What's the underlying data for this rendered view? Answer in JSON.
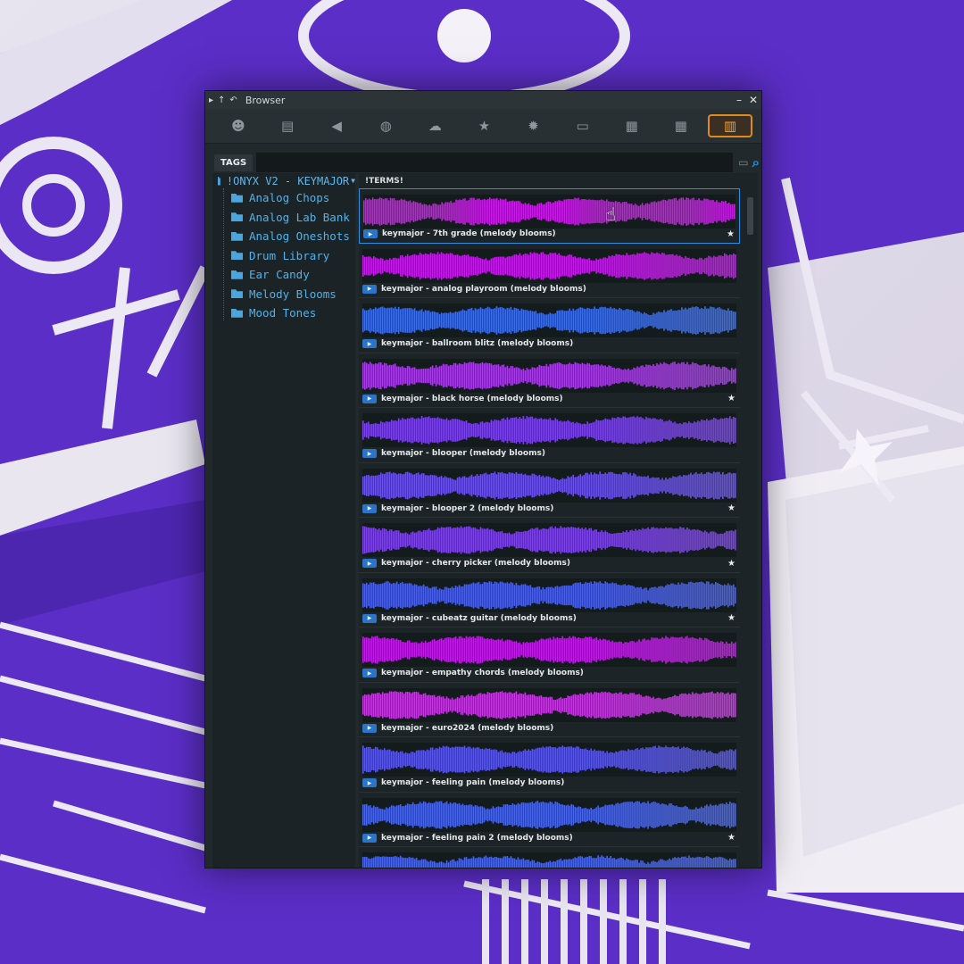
{
  "window": {
    "title": "Browser"
  },
  "icon_bar": [
    {
      "icon": "smiley-icon",
      "glyph": "☻",
      "active": false
    },
    {
      "icon": "document-icon",
      "glyph": "▤",
      "active": false
    },
    {
      "icon": "speaker-icon",
      "glyph": "◀",
      "active": false
    },
    {
      "icon": "globe-icon",
      "glyph": "◍",
      "active": false
    },
    {
      "icon": "cloud-icon",
      "glyph": "☁",
      "active": false
    },
    {
      "icon": "star-icon",
      "glyph": "★",
      "active": false
    },
    {
      "icon": "gear-icon",
      "glyph": "✹",
      "active": false
    },
    {
      "icon": "folder-icon",
      "glyph": "▭",
      "active": false
    },
    {
      "icon": "piano-roll-icon",
      "glyph": "▦",
      "active": false
    },
    {
      "icon": "channel-rack-icon",
      "glyph": "▦",
      "active": false
    },
    {
      "icon": "plugin-database-icon",
      "glyph": "▥",
      "active": true
    }
  ],
  "tags": {
    "label": "TAGS"
  },
  "tree": {
    "root": "!ONYX V2 - KEYMAJOR",
    "items": [
      "Analog Chops",
      "Analog Lab Bank",
      "Analog Oneshots",
      "Drum Library",
      "Ear Candy",
      "Melody Blooms",
      "Mood Tones"
    ]
  },
  "files": {
    "header": "!TERMS!",
    "rows": [
      {
        "name": "keymajor - 7th grade (melody blooms)",
        "starred": true,
        "selected": true,
        "color": "#c81ee6",
        "seed": 3
      },
      {
        "name": "keymajor - analog playroom (melody blooms)",
        "starred": false,
        "selected": false,
        "color": "#c21ee8",
        "seed": 7
      },
      {
        "name": "keymajor - ballroom blitz (melody blooms)",
        "starred": false,
        "selected": false,
        "color": "#3d6ee8",
        "seed": 11
      },
      {
        "name": "keymajor - black horse (melody blooms)",
        "starred": true,
        "selected": false,
        "color": "#a63de6",
        "seed": 13
      },
      {
        "name": "keymajor - blooper (melody blooms)",
        "starred": false,
        "selected": false,
        "color": "#7a44ea",
        "seed": 17
      },
      {
        "name": "keymajor - blooper 2 (melody blooms)",
        "starred": true,
        "selected": false,
        "color": "#6a52ea",
        "seed": 19
      },
      {
        "name": "keymajor - cherry picker (melody blooms)",
        "starred": true,
        "selected": false,
        "color": "#7d45e8",
        "seed": 23
      },
      {
        "name": "keymajor - cubeatz guitar (melody blooms)",
        "starred": true,
        "selected": false,
        "color": "#4b62e8",
        "seed": 29
      },
      {
        "name": "keymajor - empathy chords (melody blooms)",
        "starred": false,
        "selected": false,
        "color": "#c01ee6",
        "seed": 31
      },
      {
        "name": "keymajor - euro2024 (melody blooms)",
        "starred": false,
        "selected": false,
        "color": "#c53ae0",
        "seed": 37
      },
      {
        "name": "keymajor - feeling pain (melody blooms)",
        "starred": false,
        "selected": false,
        "color": "#5a58e8",
        "seed": 41
      },
      {
        "name": "keymajor - feeling pain 2 (melody blooms)",
        "starred": true,
        "selected": false,
        "color": "#4a66e8",
        "seed": 43
      },
      {
        "name": "",
        "starred": false,
        "selected": false,
        "color": "#4a66e8",
        "seed": 47
      }
    ]
  }
}
